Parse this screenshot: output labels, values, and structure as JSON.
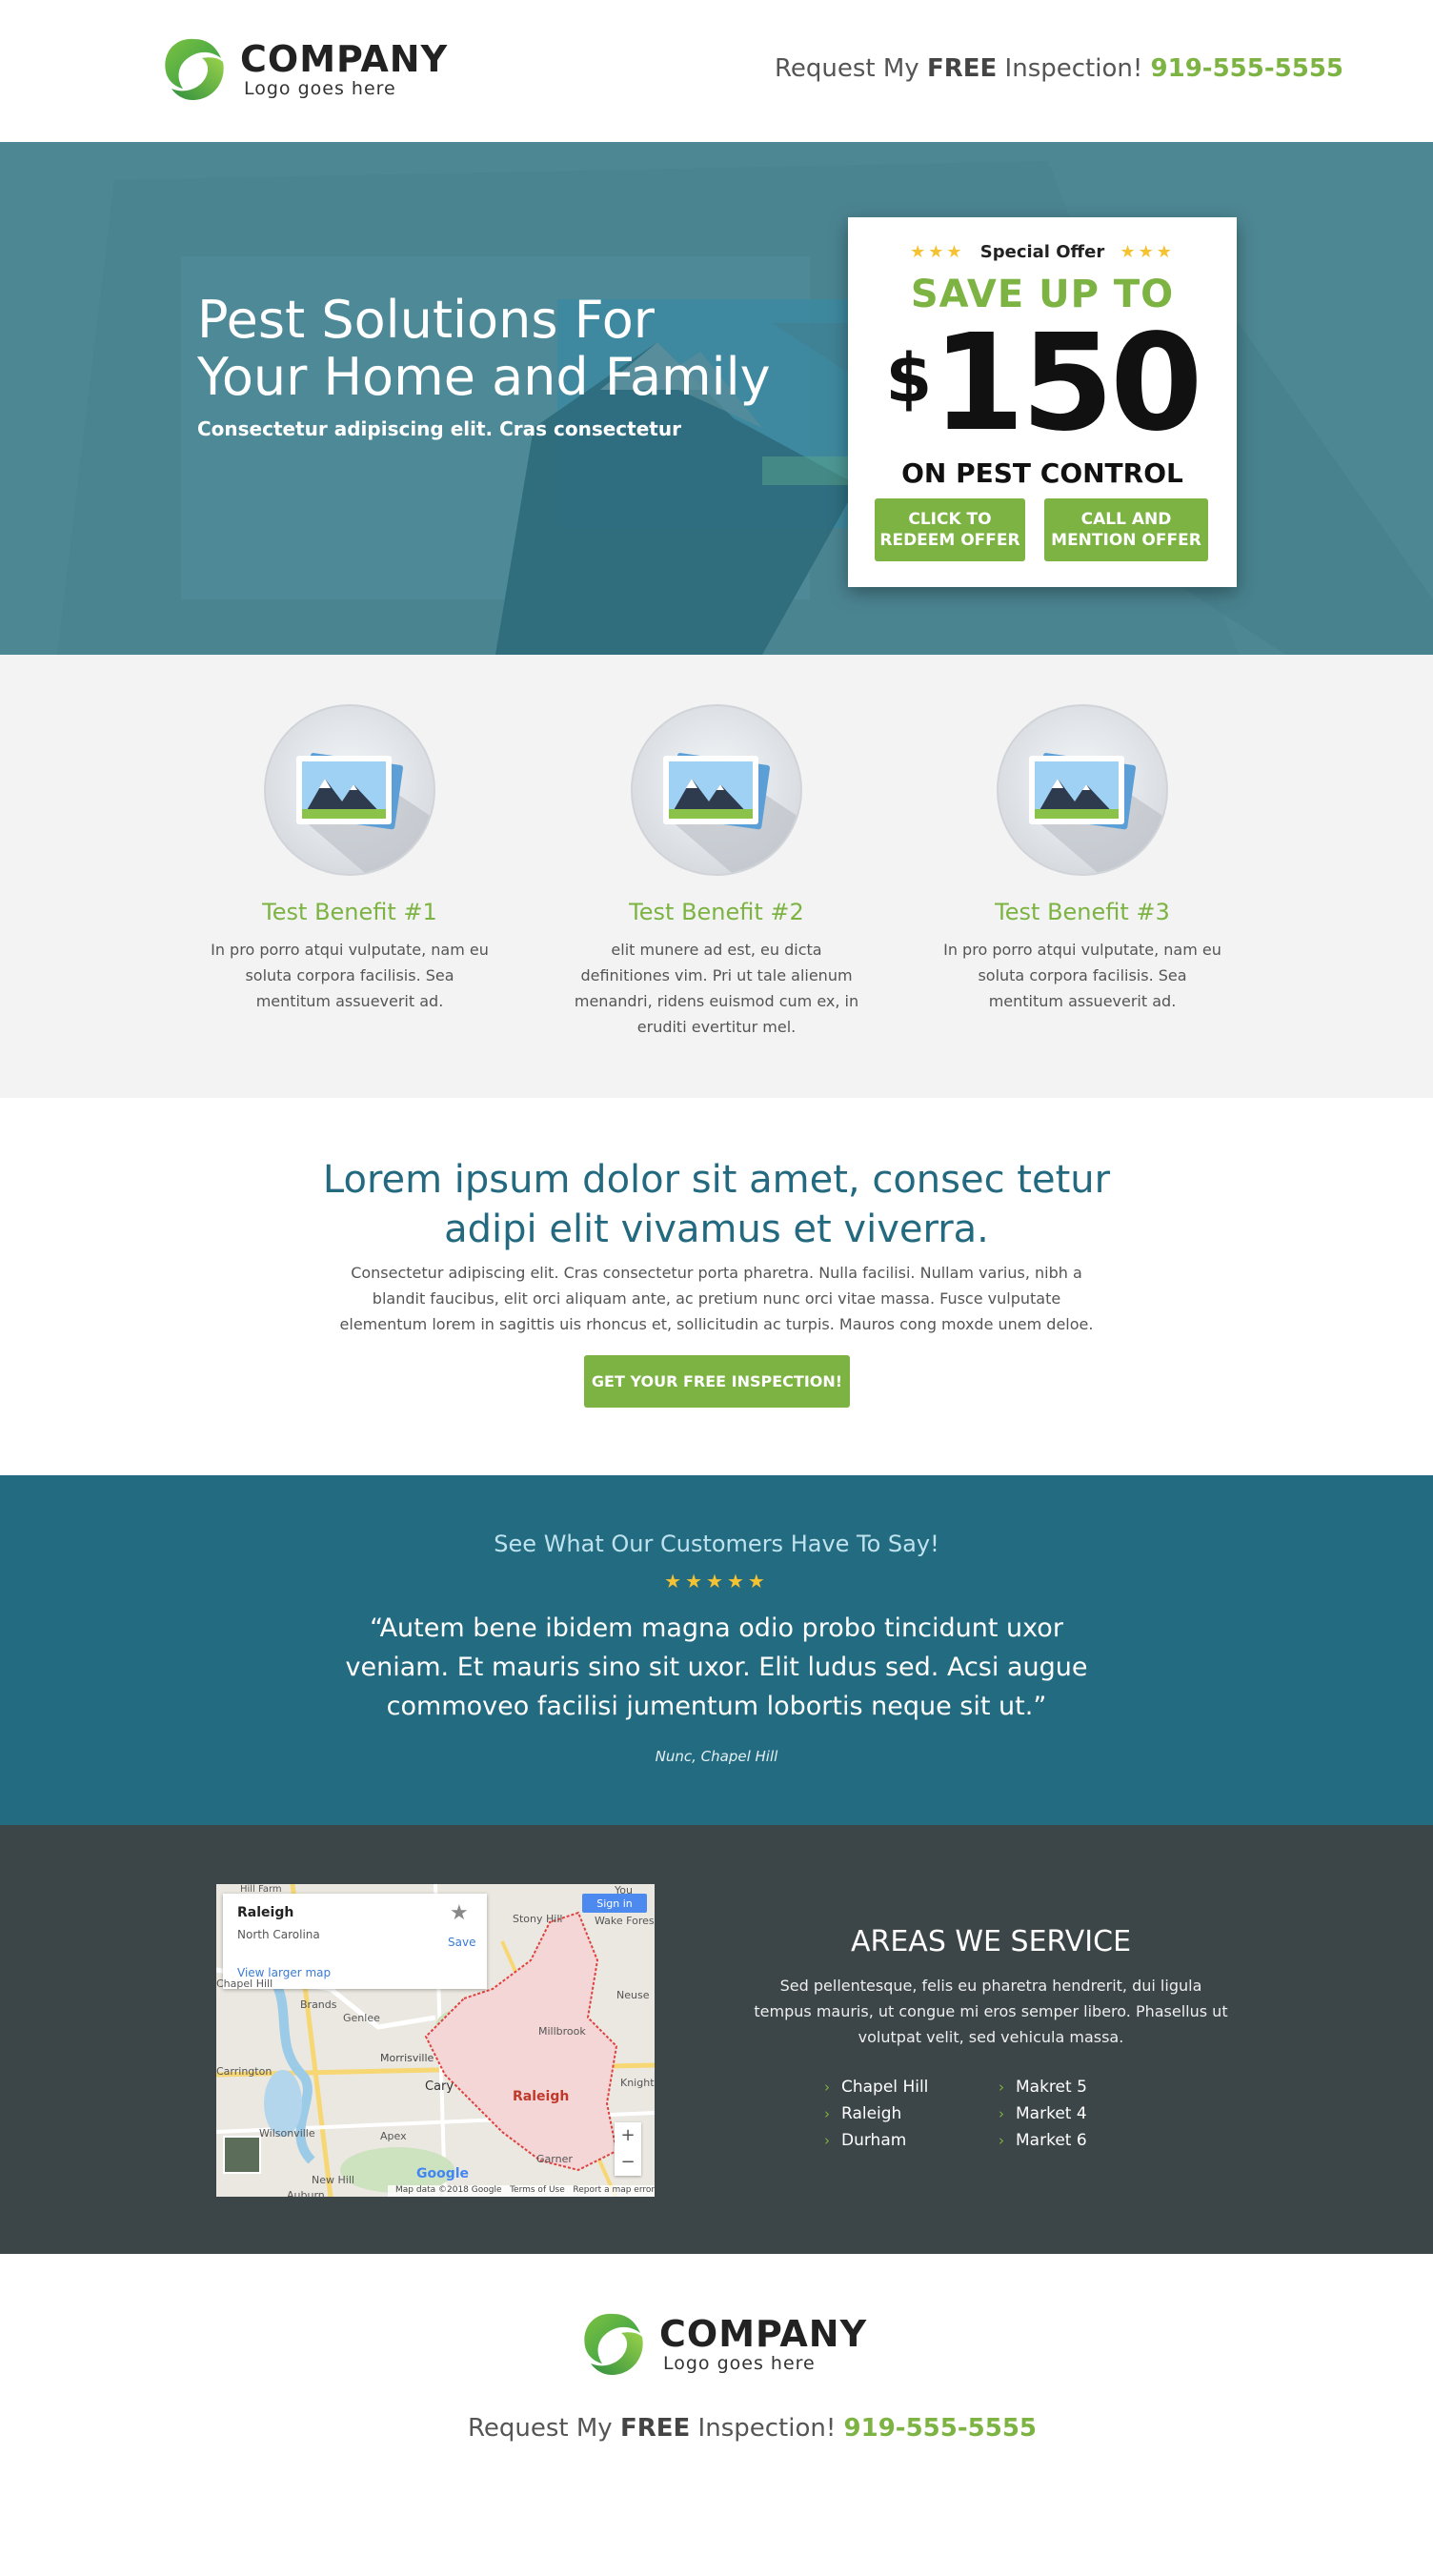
{
  "brand": {
    "name": "COMPANY",
    "tagline": "Logo goes here",
    "green": "#7cb342",
    "teal": "#236b80"
  },
  "header": {
    "cta_prefix": "Request My ",
    "cta_bold": "FREE",
    "cta_suffix": " Inspection! ",
    "phone": "919-555-5555"
  },
  "hero": {
    "title_line1": "Pest Solutions For",
    "title_line2": "Your Home and Family",
    "subtitle": "Consectetur adipiscing elit. Cras consectetur",
    "offer": {
      "label": "Special Offer",
      "headline": "SAVE UP TO",
      "currency": "$",
      "amount": "150",
      "subline": "ON PEST CONTROL",
      "button_redeem_line1": "CLICK TO",
      "button_redeem_line2": "REDEEM OFFER",
      "button_call_line1": "CALL AND",
      "button_call_line2": "MENTION OFFER"
    }
  },
  "benefits": [
    {
      "title": "Test Benefit #1",
      "text": "In pro porro atqui vulputate, nam eu soluta corpora facilisis. Sea mentitum assueverit ad.",
      "icon": "image-icon"
    },
    {
      "title": "Test Benefit #2",
      "text": "elit munere ad est, eu dicta definitiones vim. Pri ut tale alienum menandri, ridens euismod cum ex, in eruditi evertitur mel.",
      "icon": "image-icon"
    },
    {
      "title": "Test Benefit #3",
      "text": "In pro porro atqui vulputate, nam eu soluta corpora facilisis. Sea mentitum assueverit ad.",
      "icon": "image-icon"
    }
  ],
  "intro": {
    "heading_line1": "Lorem ipsum dolor sit amet, consec tetur",
    "heading_line2": "adipi elit vivamus et viverra.",
    "body": "Consectetur adipiscing elit. Cras consectetur porta pharetra. Nulla facilisi. Nullam varius, nibh a blandit faucibus, elit orci aliquam ante, ac pretium nunc orci vitae massa. Fusce vulputate elementum lorem in sagittis uis rhoncus et, sollicitudin ac turpis. Mauros cong moxde unem deloe.",
    "button": "GET YOUR FREE INSPECTION!"
  },
  "testimonial": {
    "heading": "See What Our Customers Have To Say!",
    "stars": "★★★★★",
    "quote": "“Autem bene ibidem magna odio probo tincidunt uxor veniam. Et mauris sino sit uxor. Elit ludus sed. Acsi augue commoveo facilisi jumentum lobortis neque sit ut.”",
    "author": "Nunc, Chapel Hill"
  },
  "map": {
    "place": "Raleigh",
    "region": "North Carolina",
    "save": "Save",
    "larger": "View larger map",
    "signin": "Sign in",
    "labels": [
      "Hill Farm",
      "You",
      "Stony Hill",
      "Wake Fores",
      "Chapel Hill",
      "Brands",
      "Genlee",
      "Morrisville",
      "Cary",
      "Raleigh",
      "Millbrook",
      "Knight",
      "Wilsonville",
      "Apex",
      "Garner",
      "Auburn",
      "New Hill",
      "Neuse",
      "Carrington"
    ],
    "footer": "Map data ©2018 Google   Terms of Use   Report a map error",
    "google": "Google",
    "zoom_in": "+",
    "zoom_out": "−"
  },
  "areas": {
    "heading": "AREAS WE SERVICE",
    "desc": "Sed pellentesque, felis eu pharetra hendrerit, dui ligula tempus mauris, ut congue mi eros semper libero. Phasellus ut volutpat velit, sed vehicula massa.",
    "col1": [
      "Chapel Hill",
      "Raleigh",
      "Durham"
    ],
    "col2": [
      "Makret 5",
      "Market 4",
      "Market 6"
    ]
  }
}
